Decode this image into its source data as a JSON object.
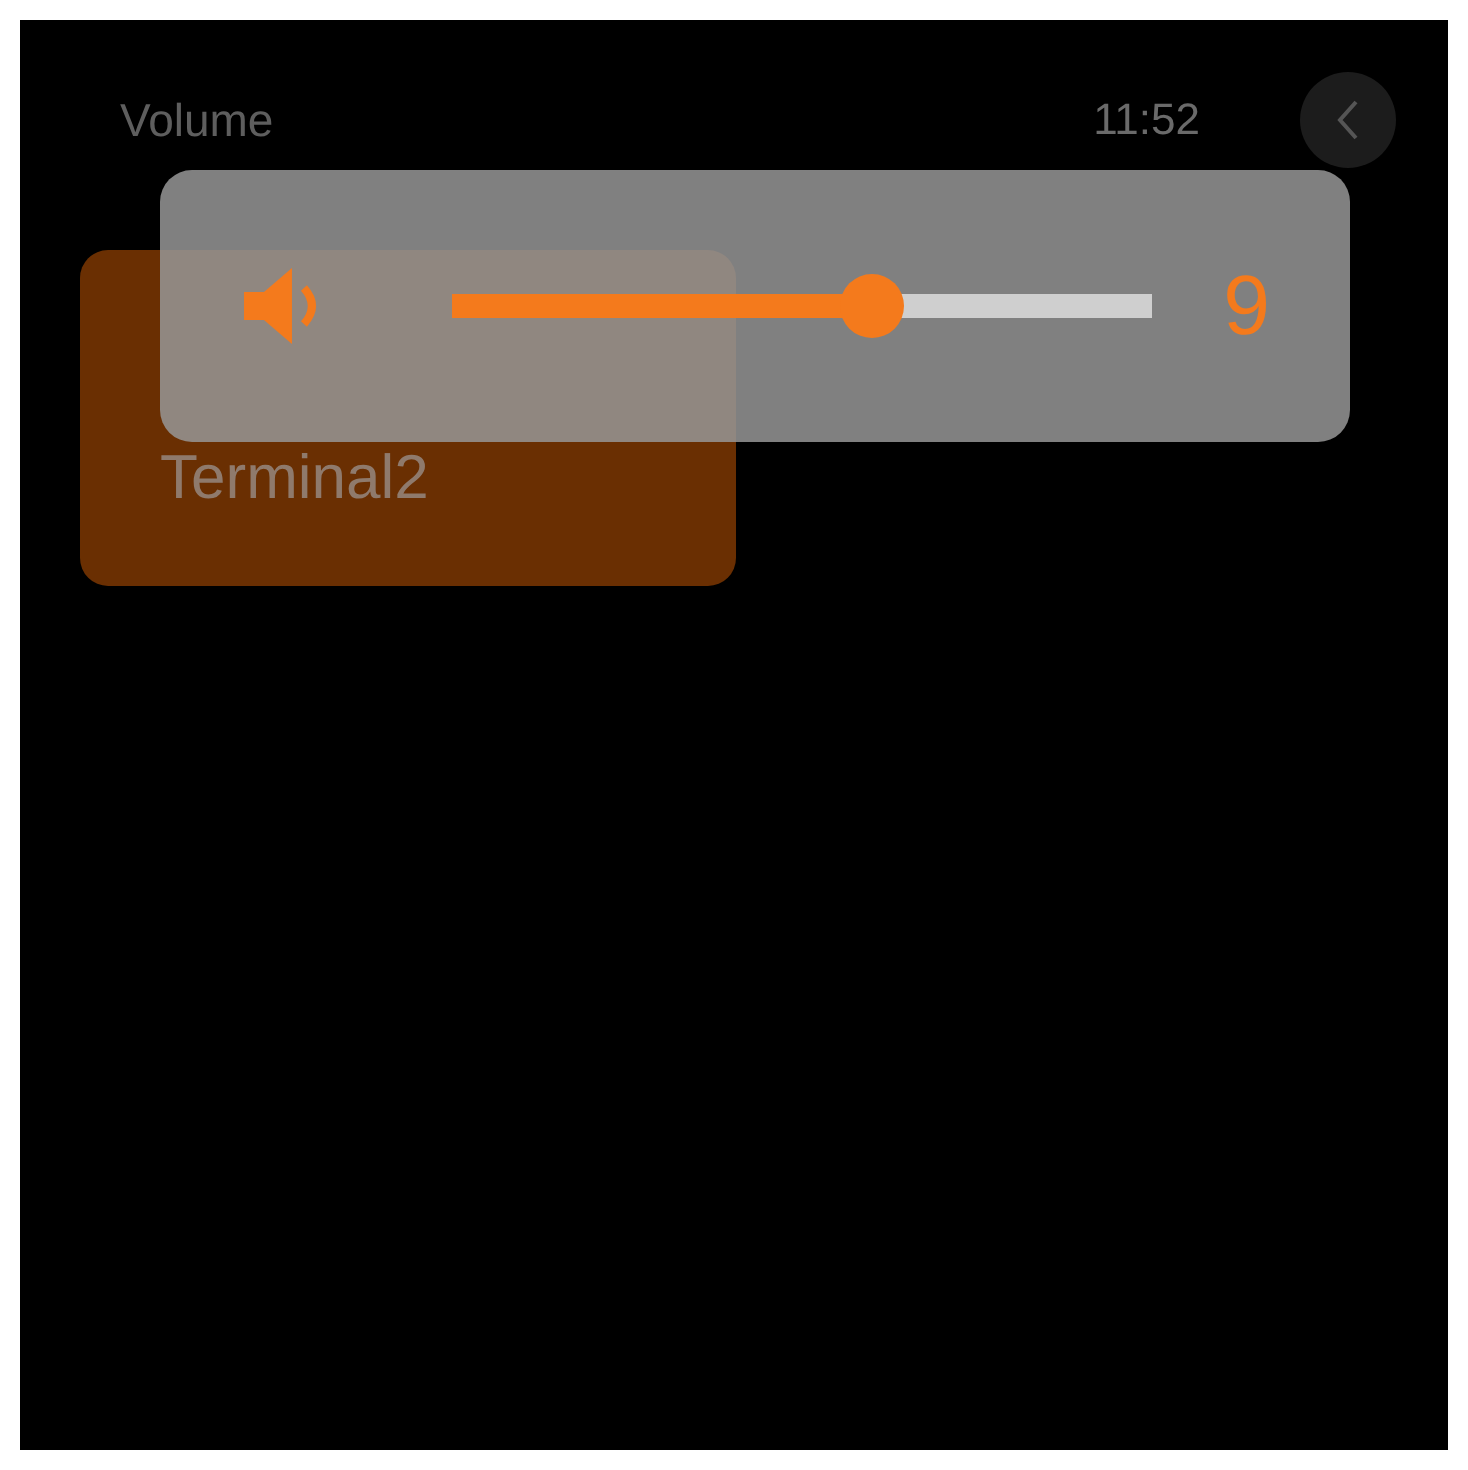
{
  "header": {
    "title": "Volume",
    "time": "11:52"
  },
  "cards": [
    {
      "label": "Terminal2"
    }
  ],
  "volume_popup": {
    "level": 0.6,
    "reading": "9"
  }
}
